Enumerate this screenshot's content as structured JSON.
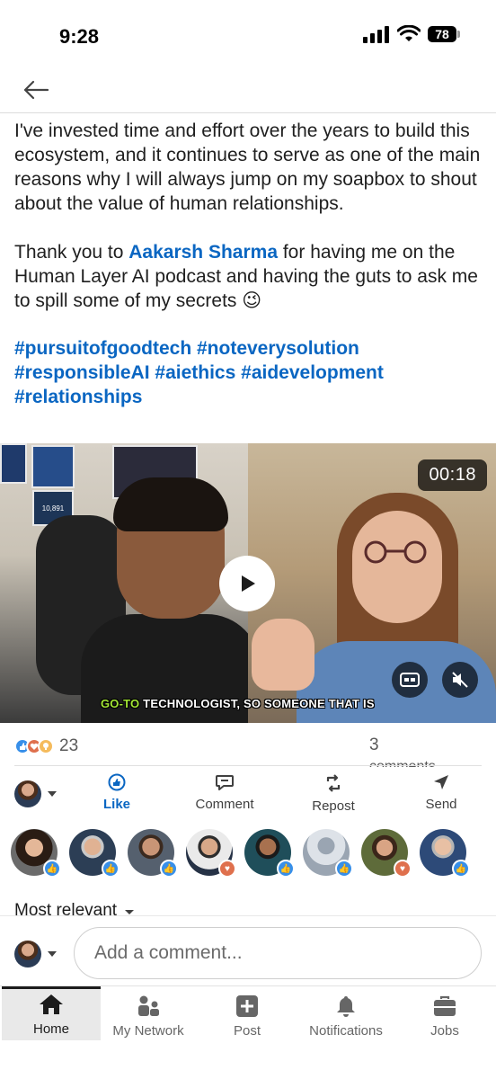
{
  "status": {
    "time": "9:28",
    "battery": "78"
  },
  "post": {
    "para1": "I've invested time and effort over the years to build this ecosystem, and it continues to serve as one of the main reasons why I will always jump on my soapbox to shout about the value of human relationships.",
    "para2_before": "Thank you to ",
    "mention": "Aakarsh Sharma",
    "para2_after": " for having me on the Human Layer AI podcast and having the guts to ask me to spill some of my secrets 😉",
    "hashtags": [
      "#pursuitofgoodtech",
      "#noteverysolution",
      "#responsibleAI",
      "#aiethics",
      "#aidevelopment",
      "#relationships"
    ]
  },
  "video": {
    "timer": "00:18",
    "caption_highlight": "GO-TO",
    "caption_rest": " TECHNOLOGIST, SO SOMEONE THAT IS",
    "poster_text": "10,891"
  },
  "stats": {
    "reactions": "23",
    "comments": "3",
    "comments_label": "comments"
  },
  "actions": [
    {
      "label": "Like",
      "icon": "like-icon"
    },
    {
      "label": "Comment",
      "icon": "comment-icon"
    },
    {
      "label": "Repost",
      "icon": "repost-icon"
    },
    {
      "label": "Send",
      "icon": "send-icon"
    }
  ],
  "sort": {
    "label": "Most relevant"
  },
  "comment": {
    "placeholder": "Add a comment..."
  },
  "tabs": [
    {
      "label": "Home",
      "icon": "home-icon"
    },
    {
      "label": "My Network",
      "icon": "network-icon"
    },
    {
      "label": "Post",
      "icon": "post-icon"
    },
    {
      "label": "Notifications",
      "icon": "bell-icon"
    },
    {
      "label": "Jobs",
      "icon": "briefcase-icon"
    }
  ],
  "colors": {
    "brand": "#0a66c2",
    "like": "#378fe9",
    "love": "#df704d"
  }
}
